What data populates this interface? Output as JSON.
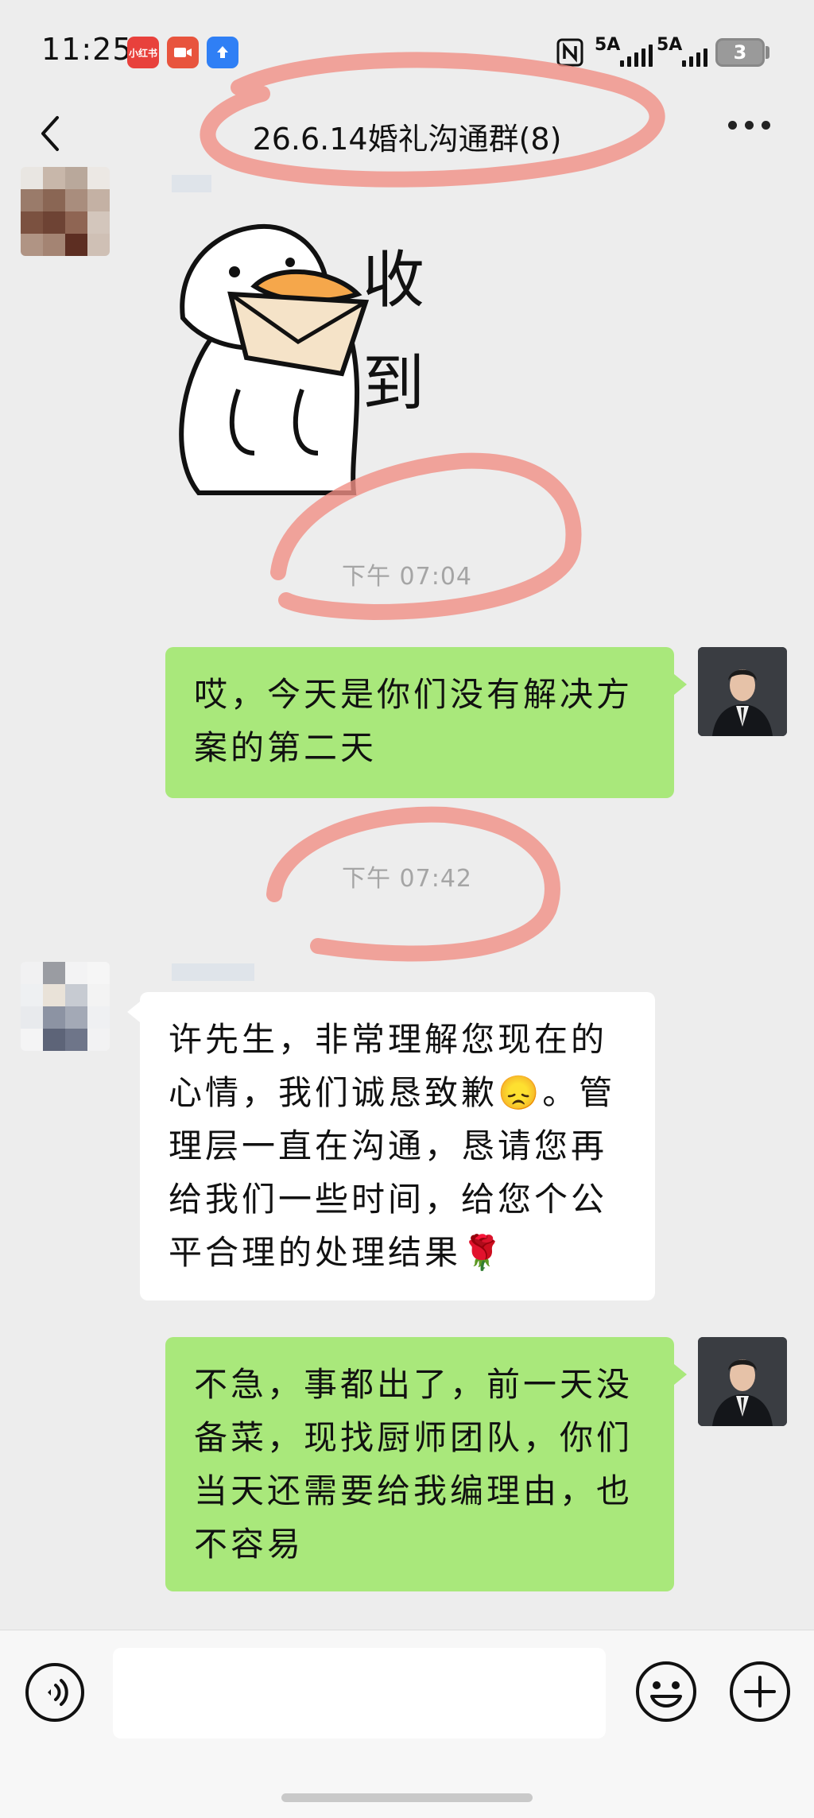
{
  "status_bar": {
    "time": "11:25",
    "app_icons": [
      {
        "label": "小红书",
        "color": "#e8413c"
      },
      {
        "label": "",
        "color": "#e8543d"
      },
      {
        "label": "",
        "color": "#2f7ff5"
      }
    ],
    "network_labels": [
      "5A",
      "5A"
    ],
    "battery": "3"
  },
  "nav": {
    "title": "26.6.14婚礼沟通群(8)"
  },
  "messages": {
    "sticker_text": [
      "收",
      "到"
    ],
    "timestamp_1": "下午 07:04",
    "me_1_lines": [
      "哎，今天是你们没有解决方",
      "案的第二天"
    ],
    "timestamp_2": "下午 07:42",
    "other_1_lines": [
      "许先生，非常理解您现在的",
      "心情，我们诚恳致歉😞。管",
      "理层一直在沟通，恳请您再",
      "给我们一些时间，给您个公",
      "平合理的处理结果🌹"
    ],
    "me_2_lines": [
      "不急，事都出了，前一天没",
      "备菜，现找厨师团队，你们",
      "当天还需要给我编理由，也",
      "不容易"
    ]
  },
  "annotation_color": "#f08f85"
}
